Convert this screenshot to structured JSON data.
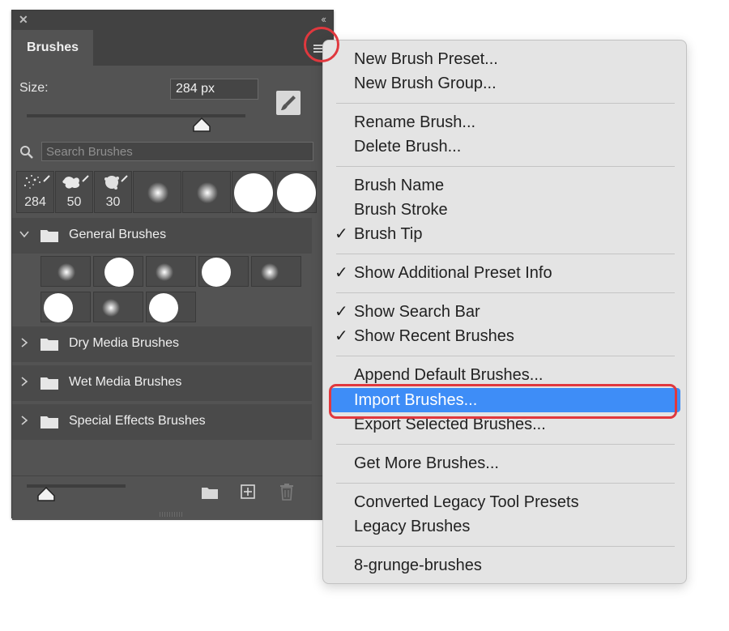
{
  "panel": {
    "tab_label": "Brushes",
    "size_label": "Size:",
    "size_value": "284 px",
    "size_slider_fraction": 0.8,
    "search_placeholder": "Search Brushes",
    "recent_brushes": [
      {
        "kind": "spatter",
        "label": "284"
      },
      {
        "kind": "splat",
        "label": "50"
      },
      {
        "kind": "burst",
        "label": "30"
      },
      {
        "kind": "soft-small",
        "label": ""
      },
      {
        "kind": "soft-small",
        "label": ""
      },
      {
        "kind": "hard-large",
        "label": ""
      },
      {
        "kind": "hard-large",
        "label": ""
      }
    ],
    "groups": [
      {
        "name": "General Brushes",
        "expanded": true
      },
      {
        "name": "Dry Media Brushes",
        "expanded": false
      },
      {
        "name": "Wet Media Brushes",
        "expanded": false
      },
      {
        "name": "Special Effects Brushes",
        "expanded": false
      }
    ],
    "general_brushes": [
      "soft",
      "hard",
      "soft",
      "hard",
      "soft",
      "hard",
      "soft",
      "hard"
    ],
    "icons": [
      "close-icon",
      "collapse-icon",
      "panel-menu-icon",
      "brush-settings-icon",
      "search-icon",
      "folder-icon",
      "new-group-icon",
      "new-brush-icon",
      "trash-icon"
    ]
  },
  "menu": {
    "items": [
      {
        "label": "New Brush Preset...",
        "checked": false
      },
      {
        "label": "New Brush Group...",
        "checked": false
      },
      {
        "label": "Rename Brush...",
        "checked": false
      },
      {
        "label": "Delete Brush...",
        "checked": false
      },
      {
        "label": "Brush Name",
        "checked": false
      },
      {
        "label": "Brush Stroke",
        "checked": false
      },
      {
        "label": "Brush Tip",
        "checked": true
      },
      {
        "label": "Show Additional Preset Info",
        "checked": true
      },
      {
        "label": "Show Search Bar",
        "checked": true
      },
      {
        "label": "Show Recent Brushes",
        "checked": true
      },
      {
        "label": "Append Default Brushes...",
        "checked": false
      },
      {
        "label": "Import Brushes...",
        "checked": false,
        "highlighted": true
      },
      {
        "label": "Export Selected Brushes...",
        "checked": false
      },
      {
        "label": "Get More Brushes...",
        "checked": false
      },
      {
        "label": "Converted Legacy Tool Presets",
        "checked": false
      },
      {
        "label": "Legacy Brushes",
        "checked": false
      },
      {
        "label": "8-grunge-brushes",
        "checked": false
      }
    ],
    "check_glyph": "✓",
    "highlight_color": "#3e8df7"
  },
  "annotation": {
    "color": "#e0383e"
  }
}
